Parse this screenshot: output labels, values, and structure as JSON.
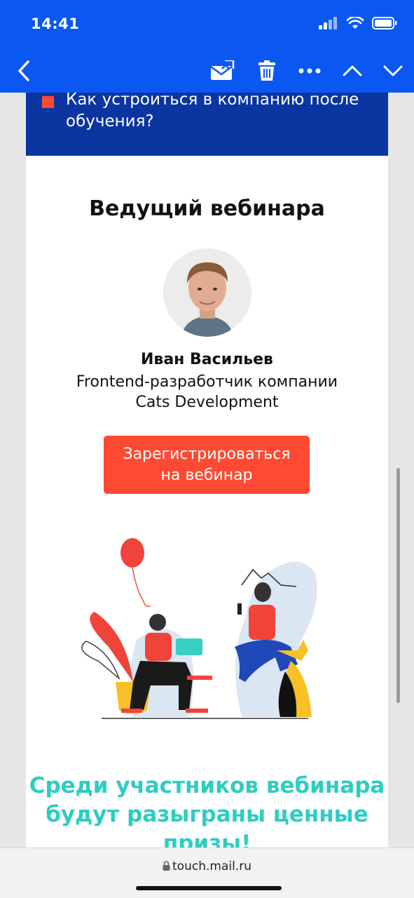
{
  "status_bar": {
    "time": "14:41"
  },
  "nav": {
    "icons": [
      "back-icon",
      "move-to-folder-icon",
      "trash-icon",
      "more-icon",
      "previous-message-icon",
      "next-message-icon"
    ]
  },
  "email": {
    "agenda_item": "Как устроиться в компанию после обучения?",
    "host_heading": "Ведущий вебинара",
    "host_name": "Иван Васильев",
    "host_role_line1": "Frontend-разработчик компании",
    "host_role_line2": "Cats Development",
    "register_line1": "Зарегистрироваться",
    "register_line2": "на вебинар",
    "prizes_line1": "Среди участников вебинара",
    "prizes_line2": "будут разыграны ценные",
    "prizes_line3": "призы!"
  },
  "browser": {
    "url": "touch.mail.ru"
  },
  "colors": {
    "brand_blue": "#0a57f2",
    "agenda_blue": "#0b35a0",
    "accent_red": "#ff4a33",
    "teal": "#2ecdc0"
  }
}
